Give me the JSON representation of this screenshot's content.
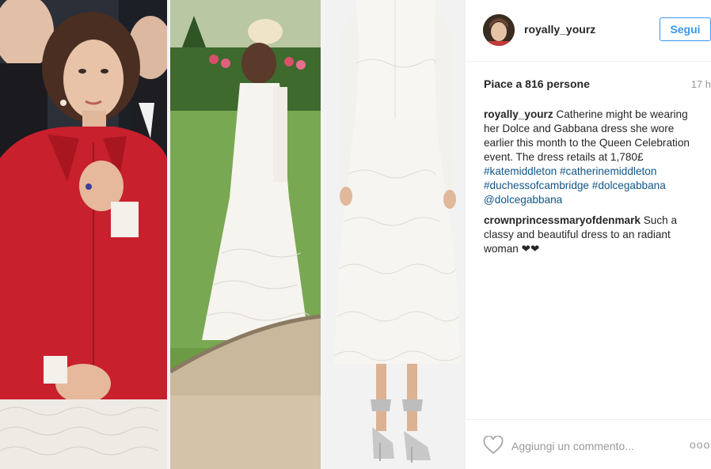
{
  "post": {
    "author": "royally_yourz",
    "follow_label": "Segui",
    "likes": "Piace a 816 persone",
    "time_ago": "17 h"
  },
  "caption": {
    "user": "royally_yourz",
    "text": " Catherine might be wearing her Dolce and Gabbana dress she wore earlier this month to the Queen Celebration event. The dress retails at 1,780£ ",
    "hashtags": [
      "#katemiddleton",
      "#catherinemiddleton",
      "#duchessofcambridge",
      "#dolcegabbana"
    ],
    "mention": "@dolcegabbana"
  },
  "comments": [
    {
      "user": "crownprincessmaryofdenmark",
      "text": " Such a classy and beautiful dress to an radiant woman ❤❤"
    }
  ],
  "footer": {
    "comment_placeholder": "Aggiungi un commento...",
    "more_label": "ooo"
  },
  "icons": {
    "like": "heart-outline-icon",
    "more": "more-options-icon"
  },
  "colors": {
    "accent_blue": "#3897f0",
    "hashtag_blue": "#125688",
    "jacket_red": "#c8202d"
  }
}
